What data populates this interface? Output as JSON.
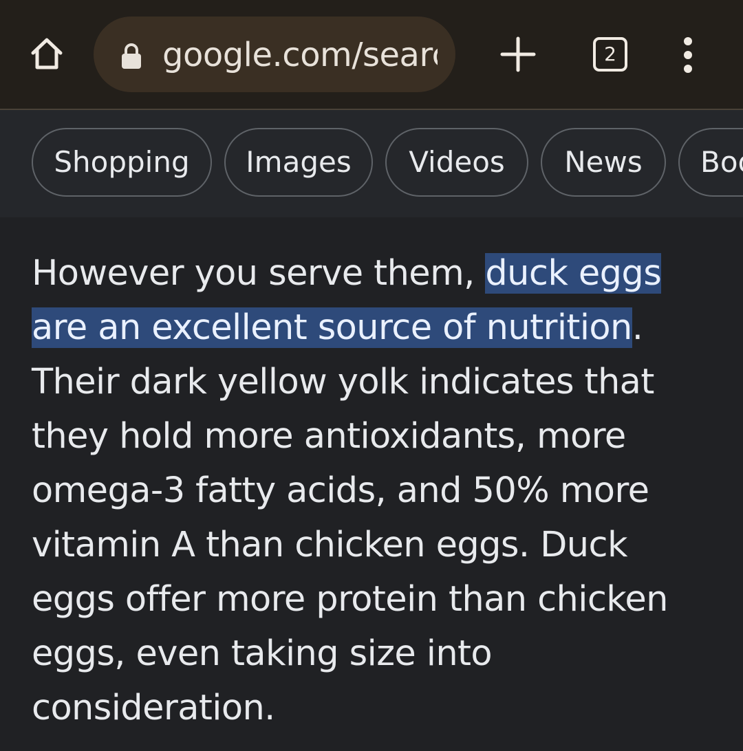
{
  "browser": {
    "url": "google.com/search",
    "tab_count": "2",
    "icons": {
      "home": "home-icon",
      "lock": "lock-icon",
      "new_tab": "plus-icon",
      "tabs": "tab-switcher-icon",
      "menu": "more-vert-icon"
    }
  },
  "chips": [
    {
      "label": "Shopping"
    },
    {
      "label": "Images"
    },
    {
      "label": "Videos"
    },
    {
      "label": "News"
    },
    {
      "label": "Books"
    }
  ],
  "snippet": {
    "before": "However you serve them, ",
    "highlight": "duck eggs are an excellent source of nutrition",
    "after": ". Their dark yellow yolk indicates that they hold more antioxidants, more omega-3 fatty acids, and 50% more vitamin A than chicken eggs. Duck eggs offer more protein than chicken eggs, even taking size into consideration."
  },
  "colors": {
    "page_bg": "#202124",
    "toolbar_bg": "#231f1a",
    "omnibox_bg": "#3a2f23",
    "highlight_bg": "#2e4a7a",
    "text": "#e8eaed"
  }
}
